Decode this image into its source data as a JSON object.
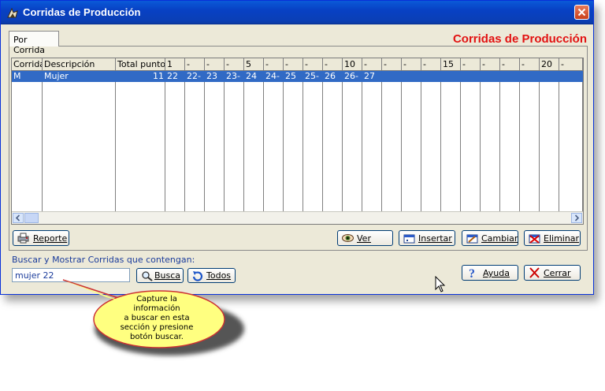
{
  "window": {
    "title": "Corridas de Producción"
  },
  "tab": {
    "label": "Por Corrida"
  },
  "header_title": "Corridas de Producción",
  "grid": {
    "columns": [
      "Corrida",
      "Descripción",
      "Total puntos",
      "1",
      "-",
      "-",
      "-",
      "5",
      "-",
      "-",
      "-",
      "-",
      "10",
      "-",
      "-",
      "-",
      "-",
      "15",
      "-",
      "-",
      "-",
      "-",
      "20",
      "-"
    ],
    "rows": [
      {
        "cells": [
          "M",
          "Mujer",
          "11",
          "22",
          "22-",
          "23",
          "23-",
          "24",
          "24-",
          "25",
          "25-",
          "26",
          "26-",
          "27"
        ],
        "selected": true
      }
    ]
  },
  "buttons": {
    "reporte": "Reporte",
    "ver": "Ver",
    "insertar": "Insertar",
    "cambiar": "Cambiar",
    "eliminar": "Eliminar",
    "busca": "Busca",
    "todos": "Todos",
    "ayuda": "Ayuda",
    "cerrar": "Cerrar"
  },
  "search": {
    "label": "Buscar y Mostrar Corridas que contengan:",
    "value": "mujer 22"
  },
  "callout": {
    "lines": [
      "Capture la información",
      "a buscar en esta",
      "sección  y presione",
      "botón buscar."
    ]
  },
  "colors": {
    "accent_red": "#e21212",
    "selection_blue": "#316ac5",
    "titlebar_blue": "#0a3fb6"
  }
}
